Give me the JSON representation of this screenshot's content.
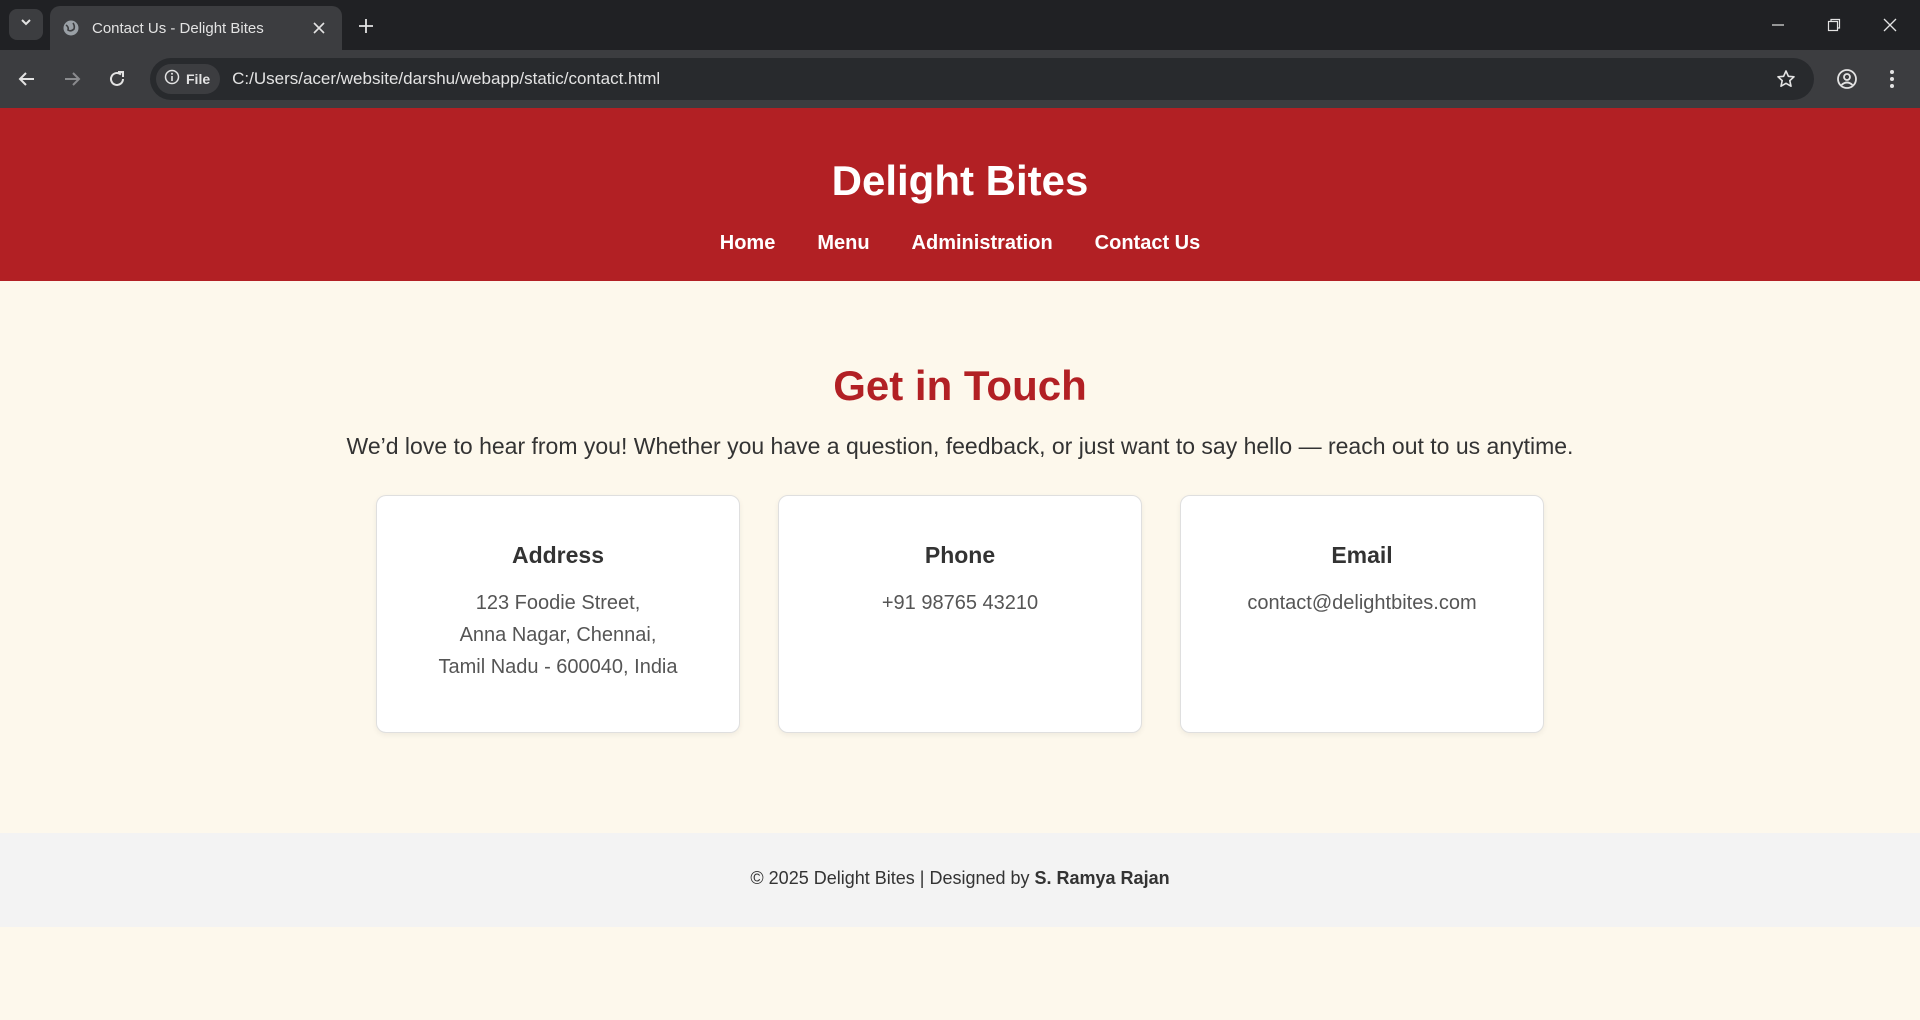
{
  "browser": {
    "tab_title": "Contact Us - Delight Bites",
    "chip_label": "File",
    "url": "C:/Users/acer/website/darshu/webapp/static/contact.html"
  },
  "header": {
    "title": "Delight Bites",
    "nav": [
      {
        "label": "Home"
      },
      {
        "label": "Menu"
      },
      {
        "label": "Administration"
      },
      {
        "label": "Contact Us"
      }
    ]
  },
  "contact": {
    "heading": "Get in Touch",
    "lead": "We’d love to hear from you! Whether you have a question, feedback, or just want to say hello — reach out to us anytime.",
    "cards": [
      {
        "title": "Address",
        "lines": [
          "123 Foodie Street,",
          "Anna Nagar, Chennai,",
          "Tamil Nadu - 600040, India"
        ]
      },
      {
        "title": "Phone",
        "lines": [
          "+91 98765 43210"
        ]
      },
      {
        "title": "Email",
        "lines": [
          "contact@delightbites.com"
        ]
      }
    ]
  },
  "footer": {
    "text": "© 2025 Delight Bites | Designed by",
    "author": "S. Ramya Rajan"
  },
  "colors": {
    "brand_red": "#b22024",
    "page_bg": "#fdf8ec",
    "footer_bg": "#f3f3f3"
  }
}
